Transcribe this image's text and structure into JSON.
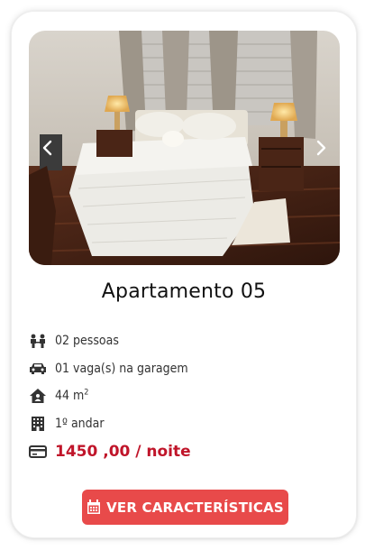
{
  "listing": {
    "title": "Apartamento 05",
    "features": {
      "guests": "02 pessoas",
      "parking": "01 vaga(s) na garagem",
      "area_value": "44 m",
      "area_unit_sup": "2",
      "floor": "1º andar",
      "price": "1450 ,00 / noite"
    },
    "icons": {
      "guests": "people-icon",
      "parking": "car-icon",
      "area": "house-icon",
      "floor": "building-icon",
      "price": "credit-card-icon",
      "button": "calendar-icon",
      "prev": "chevron-left-icon",
      "next": "chevron-right-icon"
    },
    "button_label": "VER CARACTERÍSTICAS"
  },
  "colors": {
    "accent": "#e84a4a",
    "price": "#c0152a"
  }
}
